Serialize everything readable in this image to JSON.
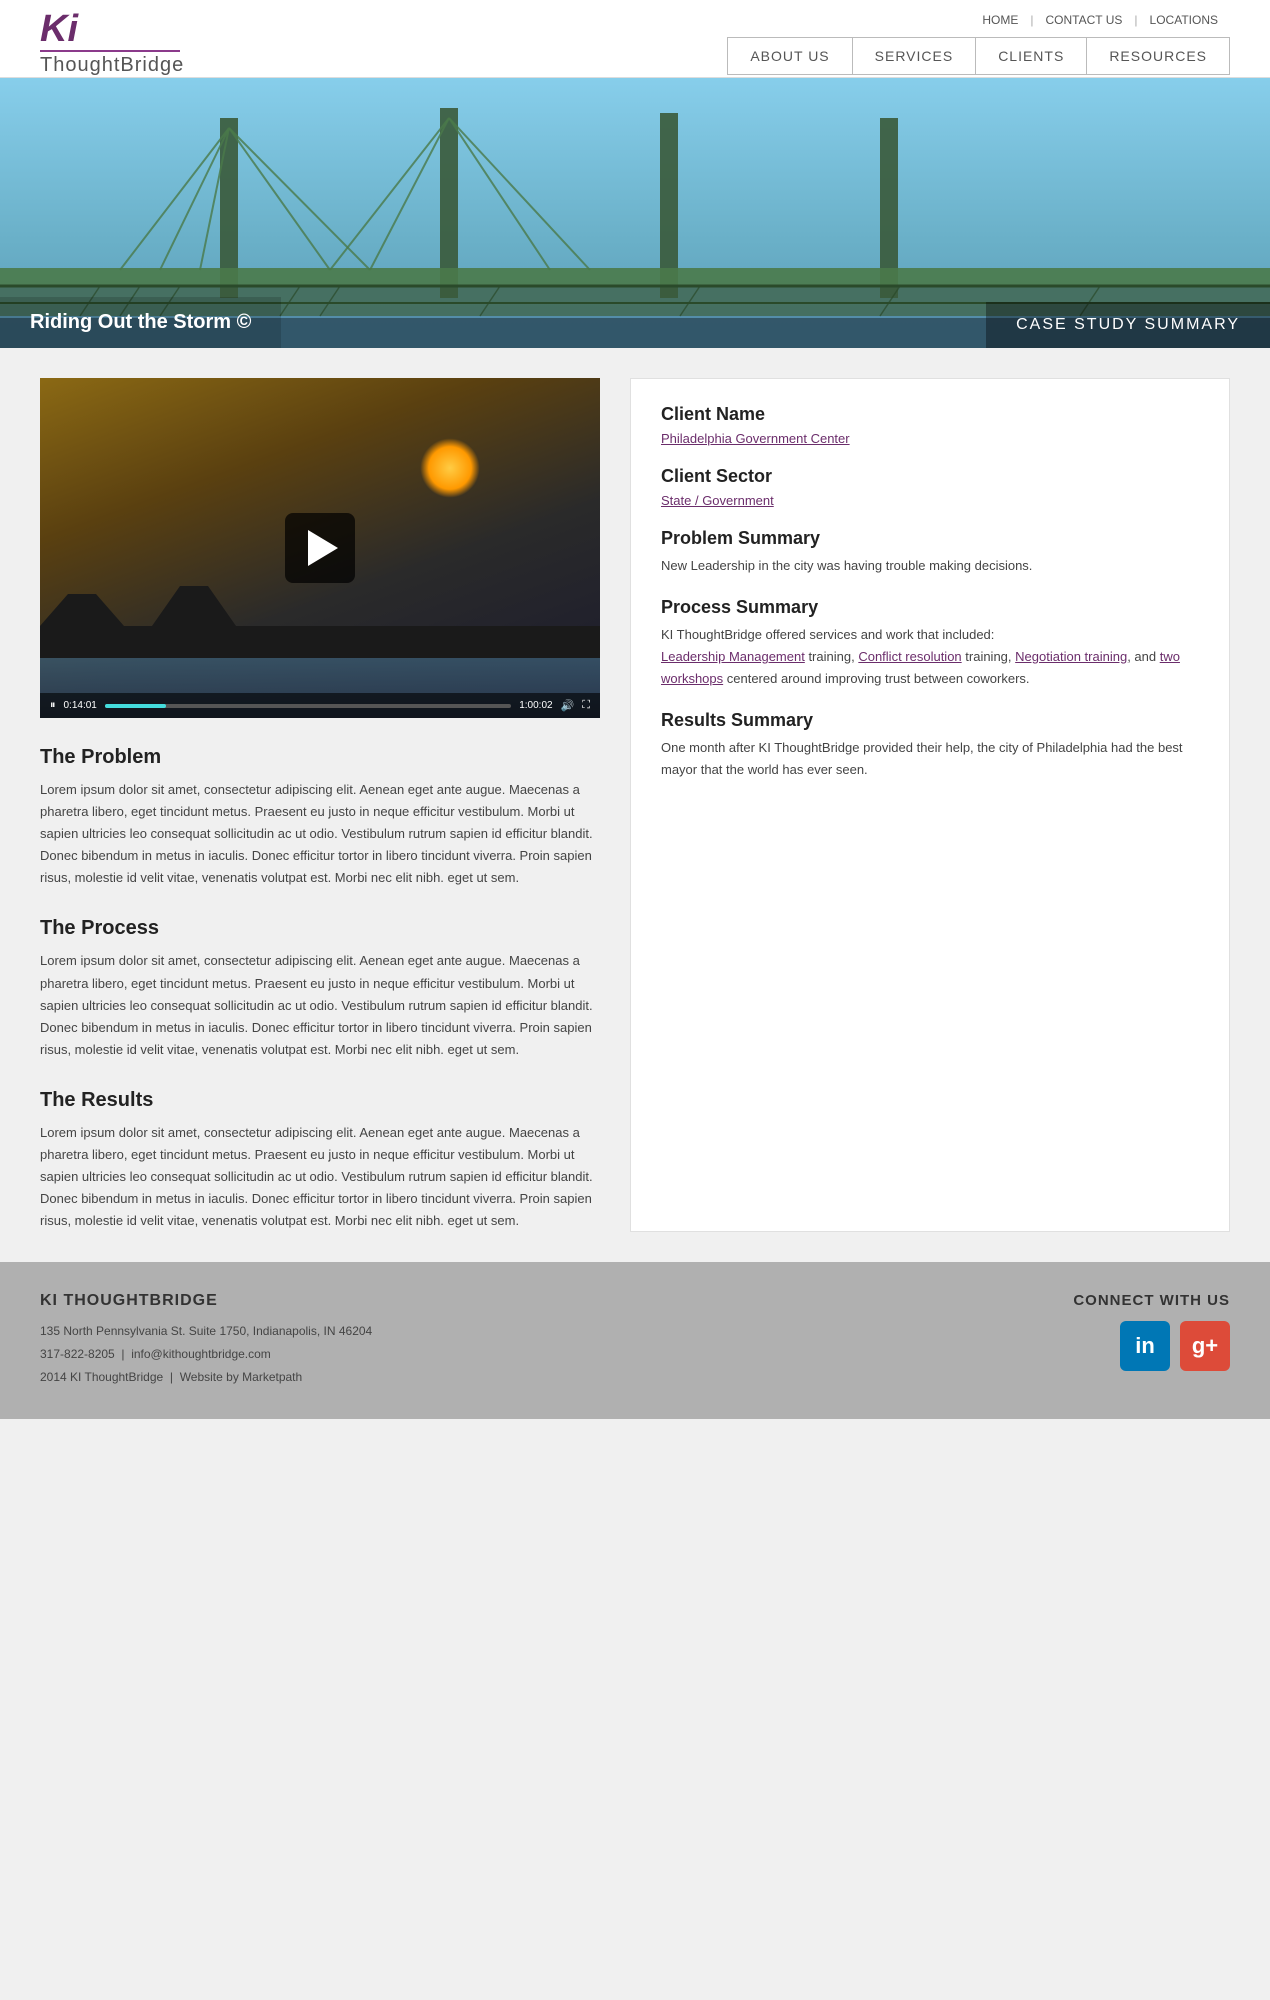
{
  "topLinks": {
    "home": "HOME",
    "contact": "CONTACT US",
    "locations": "LOCATIONS"
  },
  "logo": {
    "ki": "Ki",
    "brand": "ThoughtBridge"
  },
  "nav": {
    "aboutUs": "ABOUT US",
    "services": "SERVICES",
    "clients": "CLIENTS",
    "resources": "RESOURCES"
  },
  "hero": {
    "title": "Riding Out the Storm ©",
    "caseStudy": "CASE STUDY SUMMARY"
  },
  "video": {
    "timeElapsed": "0:14:01",
    "totalTime": "1:00:02"
  },
  "sections": {
    "problem": {
      "title": "The Problem",
      "body": "Lorem ipsum dolor sit amet, consectetur adipiscing elit. Aenean eget ante augue. Maecenas a pharetra libero, eget tincidunt metus. Praesent eu justo in neque efficitur vestibulum. Morbi ut sapien ultricies leo consequat sollicitudin ac ut odio. Vestibulum rutrum sapien id efficitur blandit. Donec bibendum in metus in iaculis. Donec efficitur tortor in libero tincidunt viverra. Proin sapien risus, molestie id velit vitae, venenatis volutpat est. Morbi nec elit nibh.\neget ut sem."
    },
    "process": {
      "title": "The Process",
      "body": "Lorem ipsum dolor sit amet, consectetur adipiscing elit. Aenean eget ante augue. Maecenas a pharetra libero, eget tincidunt metus. Praesent eu justo in neque efficitur vestibulum. Morbi ut sapien ultricies leo consequat sollicitudin ac ut odio. Vestibulum rutrum sapien id efficitur blandit. Donec bibendum in metus in iaculis. Donec efficitur tortor in libero tincidunt viverra. Proin sapien risus, molestie id velit vitae, venenatis volutpat est. Morbi nec elit nibh.\neget ut sem."
    },
    "results": {
      "title": "The Results",
      "body": "Lorem ipsum dolor sit amet, consectetur adipiscing elit. Aenean eget ante augue. Maecenas a pharetra libero, eget tincidunt metus. Praesent eu justo in neque efficitur vestibulum. Morbi ut sapien ultricies leo consequat sollicitudin ac ut odio. Vestibulum rutrum sapien id efficitur blandit. Donec bibendum in metus in iaculis. Donec efficitur tortor in libero tincidunt viverra. Proin sapien risus, molestie id velit vitae, venenatis volutpat est. Morbi nec elit nibh.\neget ut sem."
    }
  },
  "sidebar": {
    "clientName": {
      "label": "Client Name",
      "value": "Philadelphia Government Center"
    },
    "clientSector": {
      "label": "Client Sector",
      "value": "State / Government"
    },
    "problemSummary": {
      "label": "Problem Summary",
      "text": "New Leadership in the city was having trouble making decisions."
    },
    "processSummary": {
      "label": "Process Summary",
      "intro": "KI ThoughtBridge offered services and work that included:",
      "link1": "Leadership Management",
      "link1after": " training,",
      "link2": "Conflict resolution",
      "link2after": " training,",
      "link3": "Negotiation training",
      "link3after": ", and ",
      "link4": "two workshops",
      "link4after": " centered around improving trust between coworkers."
    },
    "resultsSummary": {
      "label": "Results Summary",
      "text": "One month after KI ThoughtBridge provided their help, the city of Philadelphia had the best mayor that the world has ever seen."
    }
  },
  "footer": {
    "brand": "KI THOUGHTBRIDGE",
    "address": "135 North Pennsylvania St. Suite 1750, Indianapolis, IN 46204",
    "phone": "317-822-8205",
    "phoneSep": "|",
    "email": "info@kithoughtbridge.com",
    "copyright": "2014 KI ThoughtBridge",
    "copyrightSep": "|",
    "websiteBy": "Website by Marketpath",
    "connect": "CONNECT WITH US",
    "linkedinLabel": "in",
    "gplusLabel": "g+"
  }
}
